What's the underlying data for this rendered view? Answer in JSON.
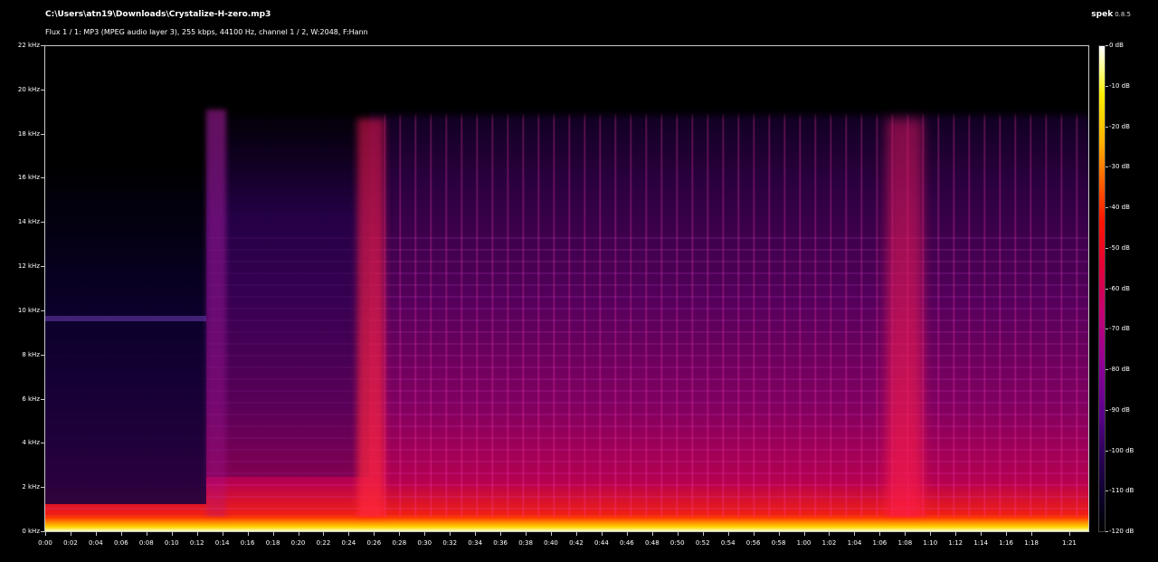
{
  "header": {
    "file_title": "C:\\Users\\atn19\\Downloads\\Crystalize-H-zero.mp3",
    "file_info": "Flux 1 / 1: MP3 (MPEG audio layer 3), 255 kbps, 44100 Hz, channel 1 / 2, W:2048, F:Hann",
    "app_name": "spek",
    "app_version": "0.8.5"
  },
  "y_axis": {
    "labels": [
      "22 kHz",
      "20 kHz",
      "18 kHz",
      "16 kHz",
      "14 kHz",
      "12 kHz",
      "10 kHz",
      "8 kHz",
      "6 kHz",
      "4 kHz",
      "2 kHz",
      "0 kHz"
    ],
    "values_khz": [
      22,
      20,
      18,
      16,
      14,
      12,
      10,
      8,
      6,
      4,
      2,
      0
    ]
  },
  "x_axis": {
    "labels": [
      "0:00",
      "0:02",
      "0:04",
      "0:06",
      "0:08",
      "0:10",
      "0:12",
      "0:14",
      "0:16",
      "0:18",
      "0:20",
      "0:22",
      "0:24",
      "0:26",
      "0:28",
      "0:30",
      "0:32",
      "0:34",
      "0:36",
      "0:38",
      "0:40",
      "0:42",
      "0:44",
      "0:46",
      "0:48",
      "0:50",
      "0:52",
      "0:54",
      "0:56",
      "0:58",
      "1:00",
      "1:02",
      "1:04",
      "1:06",
      "1:08",
      "1:10",
      "1:12",
      "1:14",
      "1:16",
      "1:18",
      "1:21"
    ],
    "values_sec": [
      0,
      2,
      4,
      6,
      8,
      10,
      12,
      14,
      16,
      18,
      20,
      22,
      24,
      26,
      28,
      30,
      32,
      34,
      36,
      38,
      40,
      42,
      44,
      46,
      48,
      50,
      52,
      54,
      56,
      58,
      60,
      62,
      64,
      66,
      68,
      70,
      72,
      74,
      76,
      78,
      81
    ]
  },
  "colorbar": {
    "labels": [
      "0 dB",
      "-10 dB",
      "-20 dB",
      "-30 dB",
      "-40 dB",
      "-50 dB",
      "-60 dB",
      "-70 dB",
      "-80 dB",
      "-90 dB",
      "-100 dB",
      "-110 dB",
      "-120 dB"
    ],
    "values_db": [
      0,
      -10,
      -20,
      -30,
      -40,
      -50,
      -60,
      -70,
      -80,
      -90,
      -100,
      -110,
      -120
    ],
    "colors": [
      "#ffffff",
      "#ffee00",
      "#ff6000",
      "#ff1400",
      "#c00078",
      "#5a008c",
      "#0e0030",
      "#000000"
    ]
  }
}
